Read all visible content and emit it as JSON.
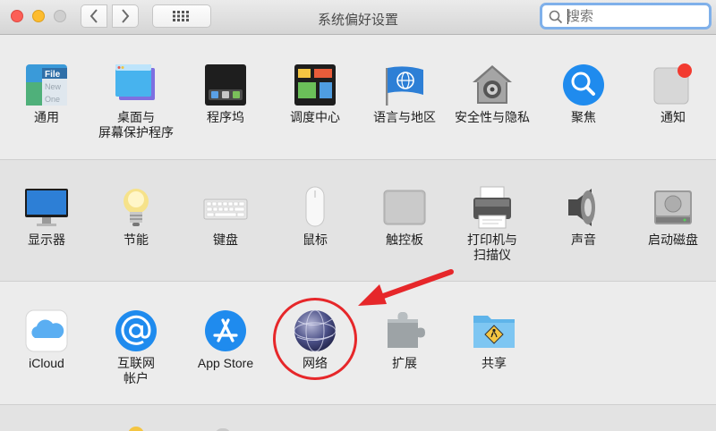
{
  "window": {
    "title": "系统偏好设置"
  },
  "toolbar": {
    "back_icon": "chevron-left-icon",
    "forward_icon": "chevron-right-icon",
    "grid_icon": "grid-icon"
  },
  "search": {
    "placeholder": "搜索",
    "icon": "magnifier-icon"
  },
  "rows": [
    {
      "items": [
        {
          "label": "通用",
          "icon": "general-icon"
        },
        {
          "label": "桌面与",
          "label2": "屏幕保护程序",
          "icon": "desktop-icon"
        },
        {
          "label": "程序坞",
          "icon": "dock-icon"
        },
        {
          "label": "调度中心",
          "icon": "mission-control-icon"
        },
        {
          "label": "语言与地区",
          "icon": "flag-globe-icon"
        },
        {
          "label": "安全性与隐私",
          "icon": "house-lock-icon"
        },
        {
          "label": "聚焦",
          "icon": "spotlight-icon"
        },
        {
          "label": "通知",
          "icon": "notifications-icon"
        }
      ]
    },
    {
      "items": [
        {
          "label": "显示器",
          "icon": "display-icon"
        },
        {
          "label": "节能",
          "icon": "lightbulb-icon"
        },
        {
          "label": "键盘",
          "icon": "keyboard-icon"
        },
        {
          "label": "鼠标",
          "icon": "mouse-icon"
        },
        {
          "label": "触控板",
          "icon": "trackpad-icon"
        },
        {
          "label": "打印机与",
          "label2": "扫描仪",
          "icon": "printer-icon"
        },
        {
          "label": "声音",
          "icon": "speaker-icon"
        },
        {
          "label": "启动磁盘",
          "icon": "disk-icon"
        }
      ]
    },
    {
      "items": [
        {
          "label": "iCloud",
          "icon": "icloud-icon"
        },
        {
          "label": "互联网",
          "label2": "帐户",
          "icon": "at-icon"
        },
        {
          "label": "App Store",
          "icon": "appstore-icon"
        },
        {
          "label": "网络",
          "icon": "network-globe-icon"
        },
        {
          "label": "扩展",
          "icon": "puzzle-icon"
        },
        {
          "label": "共享",
          "icon": "sharing-folder-icon"
        }
      ]
    }
  ],
  "general_icon_text": [
    "File",
    "New",
    "One"
  ],
  "colors": {
    "annotation": "#e6272a",
    "search_focus": "#7fb0ea"
  }
}
